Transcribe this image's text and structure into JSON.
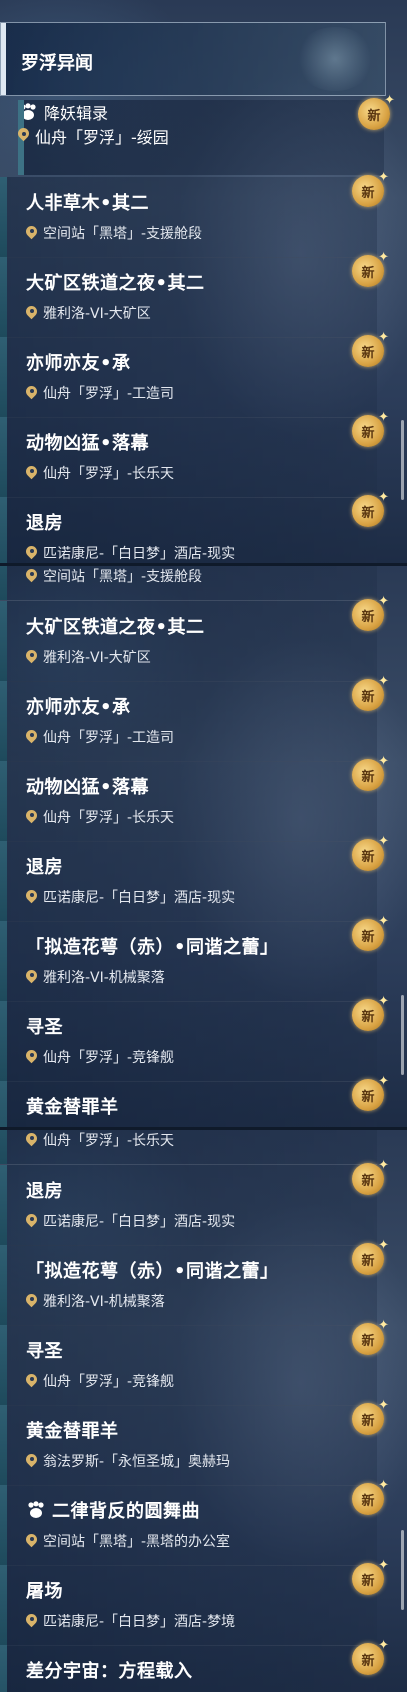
{
  "header": {
    "title": "罗浮异闻"
  },
  "badge_label": "新",
  "colors": {
    "pin": "#d9b46a",
    "badge": "#d9a344",
    "accent": "#3d7285"
  },
  "panels": [
    {
      "items": [
        {
          "title": "降妖辑录",
          "location": "仙舟「罗浮」-绥园",
          "icon": "paw-icon",
          "sub": true
        },
        {
          "title": "人非草木•其二",
          "location": "空间站「黑塔」-支援舱段"
        },
        {
          "title": "大矿区铁道之夜•其二",
          "location": "雅利洛-VI-大矿区"
        },
        {
          "title": "亦师亦友•承",
          "location": "仙舟「罗浮」-工造司"
        },
        {
          "title": "动物凶猛•落幕",
          "location": "仙舟「罗浮」-长乐天"
        },
        {
          "title": "退房",
          "location": "匹诺康尼-「白日梦」酒店-现实"
        }
      ]
    },
    {
      "top_partial": "空间站「黑塔」-支援舱段",
      "items": [
        {
          "title": "大矿区铁道之夜•其二",
          "location": "雅利洛-VI-大矿区"
        },
        {
          "title": "亦师亦友•承",
          "location": "仙舟「罗浮」-工造司"
        },
        {
          "title": "动物凶猛•落幕",
          "location": "仙舟「罗浮」-长乐天"
        },
        {
          "title": "退房",
          "location": "匹诺康尼-「白日梦」酒店-现实"
        },
        {
          "title": "「拟造花萼（赤）•同谐之蕾」",
          "location": "雅利洛-VI-机械聚落"
        },
        {
          "title": "寻圣",
          "location": "仙舟「罗浮」-竞锋舰"
        },
        {
          "title": "黄金替罪羊",
          "location": ""
        }
      ]
    },
    {
      "top_partial": "仙舟「罗浮」-长乐天",
      "items": [
        {
          "title": "退房",
          "location": "匹诺康尼-「白日梦」酒店-现实"
        },
        {
          "title": "「拟造花萼（赤）•同谐之蕾」",
          "location": "雅利洛-VI-机械聚落"
        },
        {
          "title": "寻圣",
          "location": "仙舟「罗浮」-竞锋舰"
        },
        {
          "title": "黄金替罪羊",
          "location": "翁法罗斯-「永恒圣城」奥赫玛"
        },
        {
          "title": "二律背反的圆舞曲",
          "location": "空间站「黑塔」-黑塔的办公室",
          "icon": "paw-icon"
        },
        {
          "title": "屠场",
          "location": "匹诺康尼-「白日梦」酒店-梦境"
        },
        {
          "title": "差分宇宙：方程载入",
          "location": ""
        }
      ]
    }
  ]
}
